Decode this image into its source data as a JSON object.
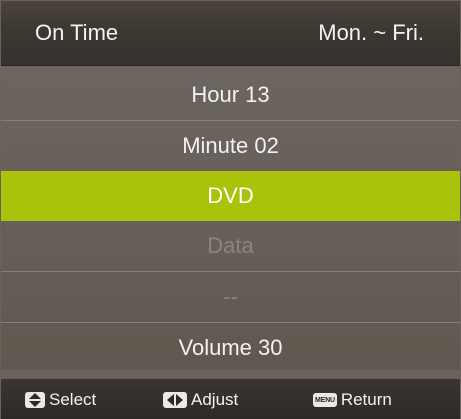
{
  "header": {
    "title": "On Time",
    "days": "Mon. ~ Fri."
  },
  "rows": [
    {
      "label": "Hour 13",
      "state": "normal"
    },
    {
      "label": "Minute 02",
      "state": "normal"
    },
    {
      "label": "DVD",
      "state": "selected"
    },
    {
      "label": "Data",
      "state": "disabled"
    },
    {
      "label": "--",
      "state": "disabled"
    },
    {
      "label": "Volume 30",
      "state": "normal"
    }
  ],
  "footer": {
    "select_label": "Select",
    "adjust_label": "Adjust",
    "return_label": "Return",
    "menu_key_label": "MENU",
    "select_icon": "up-down-arrows-icon",
    "adjust_icon": "left-right-arrows-icon",
    "return_icon": "menu-key-icon"
  },
  "colors": {
    "highlight": "#a9c20a",
    "panel": "#6a625c",
    "header": "#3e3833"
  }
}
